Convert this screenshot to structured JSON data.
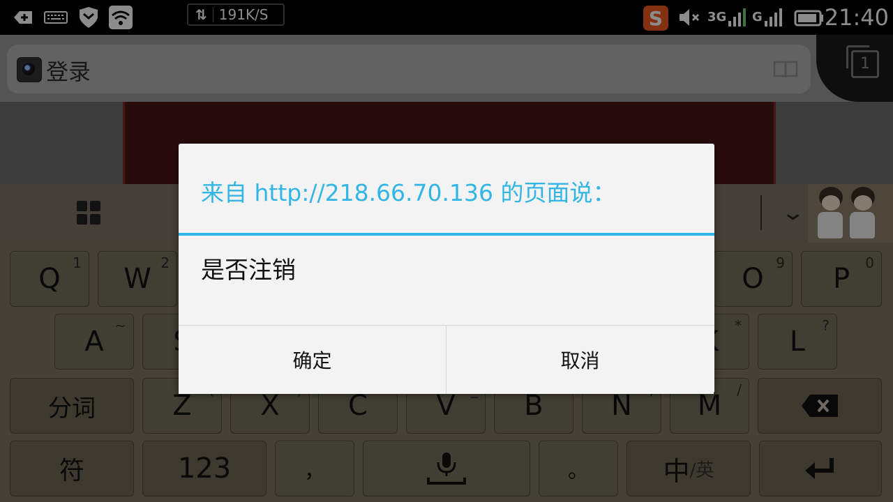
{
  "status_bar": {
    "speed": "191K/S",
    "network_3g": "3G",
    "network_g": "G",
    "time": "21:40",
    "icons": [
      "add-notification-icon",
      "keyboard-icon",
      "shield-icon",
      "wifi-icon",
      "sogou-input-icon",
      "mute-icon",
      "signal-icon",
      "battery-icon"
    ]
  },
  "browser": {
    "page_title": "登录",
    "tab_count": "1"
  },
  "keyboard": {
    "row1": [
      {
        "label": "Q",
        "sub": "1"
      },
      {
        "label": "W",
        "sub": "2"
      },
      {
        "label": "O",
        "sub": "9"
      },
      {
        "label": "P",
        "sub": "0"
      }
    ],
    "row2": [
      {
        "label": "A",
        "sub": "~"
      },
      {
        "label": "S",
        "sub": ""
      },
      {
        "label": "K",
        "sub": "*"
      },
      {
        "label": "L",
        "sub": "?"
      }
    ],
    "row3": [
      {
        "label": "分词",
        "sub": ""
      },
      {
        "label": "Z",
        "sub": "("
      },
      {
        "label": "X",
        "sub": ")"
      },
      {
        "label": "C",
        "sub": ""
      },
      {
        "label": "V",
        "sub": "_"
      },
      {
        "label": "B",
        "sub": "`"
      },
      {
        "label": "N",
        "sub": ","
      },
      {
        "label": "M",
        "sub": "/"
      }
    ],
    "row4": {
      "symbols": "符",
      "numbers": "123",
      "comma": "，",
      "period": "。",
      "lang_main": "中",
      "lang_alt": "/英"
    }
  },
  "dialog": {
    "title": "来自 http://218.66.70.136 的页面说：",
    "message": "是否注销",
    "confirm": "确定",
    "cancel": "取消",
    "accent_color": "#33b5e5"
  }
}
